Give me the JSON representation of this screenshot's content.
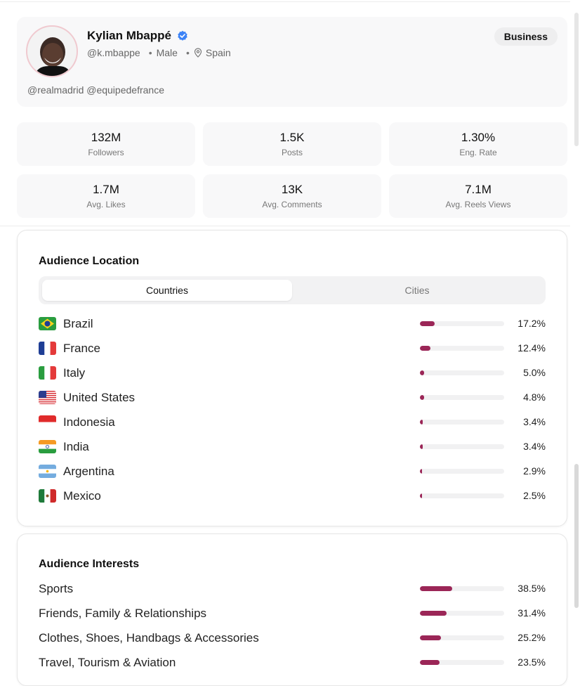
{
  "colors": {
    "accent": "#9b2657",
    "verified": "#3b82f6",
    "track": "#f1f1f2"
  },
  "profile": {
    "name": "Kylian Mbappé",
    "handle": "@k.mbappe",
    "gender": "Male",
    "location": "Spain",
    "mentions": "@realmadrid @equipedefrance",
    "badge": "Business",
    "verified_icon": "verified-check-icon",
    "location_icon": "map-pin-icon"
  },
  "stats": [
    {
      "value": "132M",
      "label": "Followers"
    },
    {
      "value": "1.5K",
      "label": "Posts"
    },
    {
      "value": "1.30%",
      "label": "Eng. Rate"
    },
    {
      "value": "1.7M",
      "label": "Avg. Likes"
    },
    {
      "value": "13K",
      "label": "Avg. Comments"
    },
    {
      "value": "7.1M",
      "label": "Avg. Reels Views"
    }
  ],
  "audience_location": {
    "title": "Audience Location",
    "tabs": [
      "Countries",
      "Cities"
    ],
    "active_tab": "Countries",
    "items": [
      {
        "name": "Brazil",
        "pct": "17.2%",
        "value": 17.2,
        "flag": "brazil-flag-icon"
      },
      {
        "name": "France",
        "pct": "12.4%",
        "value": 12.4,
        "flag": "france-flag-icon"
      },
      {
        "name": "Italy",
        "pct": "5.0%",
        "value": 5.0,
        "flag": "italy-flag-icon"
      },
      {
        "name": "United States",
        "pct": "4.8%",
        "value": 4.8,
        "flag": "usa-flag-icon"
      },
      {
        "name": "Indonesia",
        "pct": "3.4%",
        "value": 3.4,
        "flag": "indonesia-flag-icon"
      },
      {
        "name": "India",
        "pct": "3.4%",
        "value": 3.4,
        "flag": "india-flag-icon"
      },
      {
        "name": "Argentina",
        "pct": "2.9%",
        "value": 2.9,
        "flag": "argentina-flag-icon"
      },
      {
        "name": "Mexico",
        "pct": "2.5%",
        "value": 2.5,
        "flag": "mexico-flag-icon"
      }
    ]
  },
  "audience_interests": {
    "title": "Audience Interests",
    "items": [
      {
        "name": "Sports",
        "pct": "38.5%",
        "value": 38.5
      },
      {
        "name": "Friends, Family & Relationships",
        "pct": "31.4%",
        "value": 31.4
      },
      {
        "name": "Clothes, Shoes, Handbags & Accessories",
        "pct": "25.2%",
        "value": 25.2
      },
      {
        "name": "Travel, Tourism & Aviation",
        "pct": "23.5%",
        "value": 23.5
      }
    ]
  }
}
